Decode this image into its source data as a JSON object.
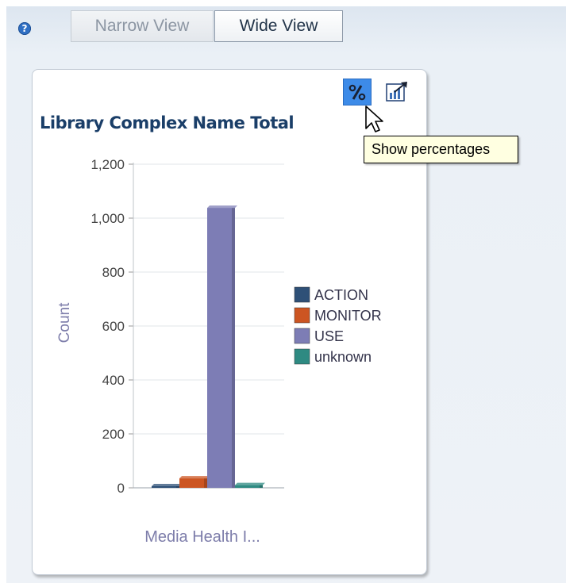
{
  "toolbar": {
    "help_icon": "?",
    "narrow_view_label": "Narrow View",
    "wide_view_label": "Wide View"
  },
  "panel": {
    "show_percentages_tooltip": "Show percentages"
  },
  "icons": {
    "percent": "percent-icon",
    "export": "export-chart-icon",
    "help": "help-icon"
  },
  "chart_data": {
    "type": "bar",
    "title": "Library Complex Name Total",
    "xlabel": "Media Health I...",
    "ylabel": "Count",
    "categories": [
      "Media Health I..."
    ],
    "ylim": [
      0,
      1200
    ],
    "yticks": [
      "0",
      "200",
      "400",
      "600",
      "800",
      "1,000",
      "1,200"
    ],
    "grid": true,
    "legend_position": "right",
    "series": [
      {
        "name": "ACTION",
        "values": [
          5
        ],
        "color": "#2e5077"
      },
      {
        "name": "MONITOR",
        "values": [
          35
        ],
        "color": "#cc5522"
      },
      {
        "name": "USE",
        "values": [
          1038
        ],
        "color": "#7d7db5"
      },
      {
        "name": "unknown",
        "values": [
          10
        ],
        "color": "#2e8a82"
      }
    ]
  }
}
